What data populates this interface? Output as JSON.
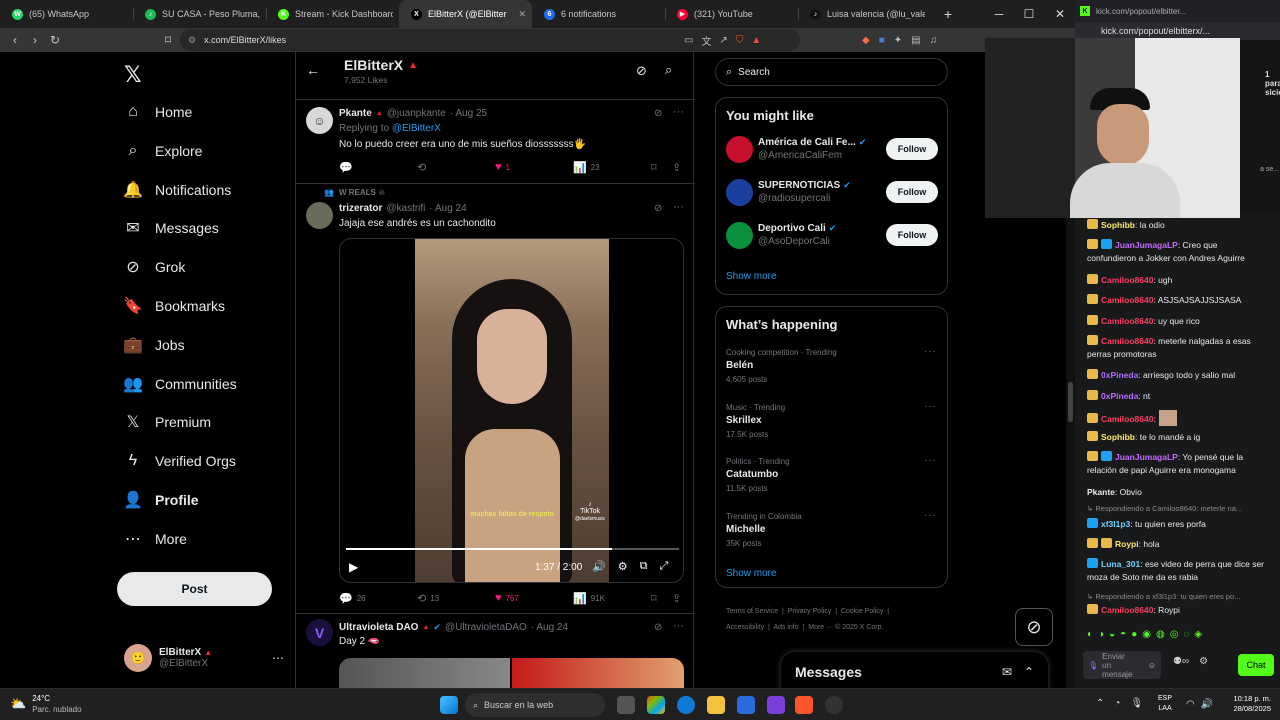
{
  "browser": {
    "tabs": [
      {
        "label": "(65) WhatsApp",
        "color": "#25d366",
        "glyph": "W"
      },
      {
        "label": "SU CASA - Peso Pluma,",
        "color": "#1db954",
        "glyph": "♪"
      },
      {
        "label": "Stream - Kick Dashboard",
        "color": "#53fc18",
        "glyph": "K"
      },
      {
        "label": "ElBitterX (@ElBitter",
        "color": "#000000",
        "glyph": "X"
      },
      {
        "label": "6 notifications",
        "color": "#1d6ff2",
        "glyph": "6"
      },
      {
        "label": "(321) YouTube",
        "color": "#ff0033",
        "glyph": "▶"
      },
      {
        "label": "Luisa valencia (@lu_valencia",
        "color": "#111111",
        "glyph": "♪"
      }
    ],
    "url": "x.com/ElBitterX/likes"
  },
  "x": {
    "nav": [
      {
        "label": "Home",
        "icon": "home-icon",
        "glyph": "⌂"
      },
      {
        "label": "Explore",
        "icon": "search-icon",
        "glyph": "⌕"
      },
      {
        "label": "Notifications",
        "icon": "bell-icon",
        "glyph": "🔔"
      },
      {
        "label": "Messages",
        "icon": "mail-icon",
        "glyph": "✉"
      },
      {
        "label": "Grok",
        "icon": "grok-icon",
        "glyph": "⊘"
      },
      {
        "label": "Bookmarks",
        "icon": "bookmark-icon",
        "glyph": "🔖"
      },
      {
        "label": "Jobs",
        "icon": "briefcase-icon",
        "glyph": "💼"
      },
      {
        "label": "Communities",
        "icon": "people-icon",
        "glyph": "👥"
      },
      {
        "label": "Premium",
        "icon": "x-icon",
        "glyph": "𝕏"
      },
      {
        "label": "Verified Orgs",
        "icon": "bolt-icon",
        "glyph": "ϟ"
      },
      {
        "label": "Profile",
        "icon": "person-icon",
        "glyph": "👤"
      },
      {
        "label": "More",
        "icon": "more-icon",
        "glyph": "⋯"
      }
    ],
    "post_label": "Post",
    "account": {
      "name": "ElBitterX",
      "handle": "@ElBitterX"
    },
    "header": {
      "title": "ElBitterX",
      "subtitle": "7,952 Likes"
    },
    "tweets": [
      {
        "name": "Pkante",
        "handle": "@juanpkante",
        "date": "· Aug 25",
        "replying": "Replying to",
        "replying_to": "@ElBitterX",
        "text": "No lo puedo creer era uno de mis sueños diosssssss🖐",
        "likes": "1",
        "views": "23"
      },
      {
        "social": "W REALS ☠",
        "name": "trizerator",
        "handle": "@kastrifi",
        "date": "· Aug 24",
        "text": "Jajaja ese andrés es un cachondito",
        "video_time": "1:37 / 2:00",
        "caption": "muchas faltas de respeto",
        "watermark": "TikTok",
        "wm_handle": "@daelsmusic",
        "replies": "26",
        "reposts": "13",
        "likes": "767",
        "views": "91K"
      },
      {
        "name": "Ultravioleta DAO",
        "handle": "@UltravioletaDAO",
        "date": "· Aug 24",
        "text": "Day 2 🫦"
      }
    ],
    "search_placeholder": "Search",
    "might_like": {
      "title": "You might like",
      "follow": "Follow",
      "show_more": "Show more",
      "accounts": [
        {
          "name": "América de Cali Fe...",
          "handle": "@AmericaCaliFem",
          "color": "#c8102e"
        },
        {
          "name": "SUPERNOTICIAS",
          "handle": "@radiosupercali",
          "color": "#1a3f9e"
        },
        {
          "name": "Deportivo Cali",
          "handle": "@AsoDeporCali",
          "color": "#0a8f3c"
        }
      ]
    },
    "happening": {
      "title": "What’s happening",
      "show_more": "Show more",
      "trends": [
        {
          "category": "Cooking competition · Trending",
          "name": "Belén",
          "posts": "4,605 posts"
        },
        {
          "category": "Music · Trending",
          "name": "Skrillex",
          "posts": "17.5K posts"
        },
        {
          "category": "Politics · Trending",
          "name": "Catatumbo",
          "posts": "11.5K posts"
        },
        {
          "category": "Trending in Colombia",
          "name": "Michelle",
          "posts": "35K posts"
        }
      ]
    },
    "footer": [
      "Terms of Service",
      "Privacy Policy",
      "Cookie Policy",
      "Accessibility",
      "Ads info",
      "More ···",
      "© 2025 X Corp."
    ],
    "messages_drawer": "Messages"
  },
  "kick": {
    "popup_url": "kick.com/popout/elbitter...",
    "popup_url2": "kick.com/popout/elbitterx/...",
    "side_text": [
      "1",
      "para",
      "sición"
    ],
    "side_text2": "a se...",
    "chat": [
      {
        "user": "Sophibb",
        "color": "#ffe96b",
        "msg": ": la odio",
        "badge": "gold"
      },
      {
        "user": "JuanJumagaLP",
        "color": "#c56bff",
        "msg": ": Creo que confundieron a Jokker con Andres Aguirre",
        "badge": "gold2"
      },
      {
        "user": "Camiloo8640",
        "color": "#ff3c5f",
        "msg": ": ugh",
        "badge": "gold"
      },
      {
        "user": "Camiloo8640",
        "color": "#ff3c5f",
        "msg": ": ASJSAJSAJJSJSASA",
        "badge": "gold"
      },
      {
        "user": "Camiloo8640",
        "color": "#ff3c5f",
        "msg": ": uy que rico",
        "badge": "gold"
      },
      {
        "user": "Camiloo8640",
        "color": "#ff3c5f",
        "msg": ": meterle nalgadas a esas perras promotoras",
        "badge": "gold"
      },
      {
        "user": "0xPineda",
        "color": "#b36bff",
        "msg": ": arriesgo todo y salio mal",
        "badge": "gold"
      },
      {
        "user": "0xPineda",
        "color": "#b36bff",
        "msg": ": nt",
        "badge": "gold"
      },
      {
        "user": "Camiloo8640",
        "color": "#ff3c5f",
        "msg": ":",
        "badge": "gold"
      },
      {
        "user": "Sophibb",
        "color": "#ffe96b",
        "msg": ": te lo mandé a ig",
        "badge": "gold"
      },
      {
        "user": "JuanJumagaLP",
        "color": "#c56bff",
        "msg": ": Yo pensé que la relación de papi Aguirre era monogama",
        "badge": "gold2"
      },
      {
        "user": "Pkante",
        "color": "#e7e9ea",
        "msg": ": Obvio",
        "badge": "none"
      },
      {
        "reply": "Respondiendo a Camiloo8640: meterle na..."
      },
      {
        "user": "xf3l1p3",
        "color": "#6bd3ff",
        "msg": ": tu quien eres porfa",
        "badge": "blue"
      },
      {
        "user": "Roypi",
        "color": "#ffe96b",
        "msg": ": hola",
        "badge": "gold3"
      },
      {
        "user": "Luna_301",
        "color": "#6bd3ff",
        "msg": ": ese video de perra que dice ser moza de Soto me da es rabia",
        "badge": "blue"
      },
      {
        "reply": "Respondiendo a xf3l1p3: tu quien eres po..."
      },
      {
        "user": "Camiloo8640",
        "color": "#ff3c5f",
        "msg": ": Roypi",
        "badge": "gold"
      }
    ],
    "input_placeholder": "Enviar un mensaje",
    "chat_button": "Chat"
  },
  "taskbar": {
    "weather_temp": "24°C",
    "weather_desc": "Parc. nublado",
    "search_placeholder": "Buscar en la web",
    "lang1": "ESP",
    "lang2": "LAA",
    "time": "10:18 p. m.",
    "date": "28/08/2025"
  }
}
